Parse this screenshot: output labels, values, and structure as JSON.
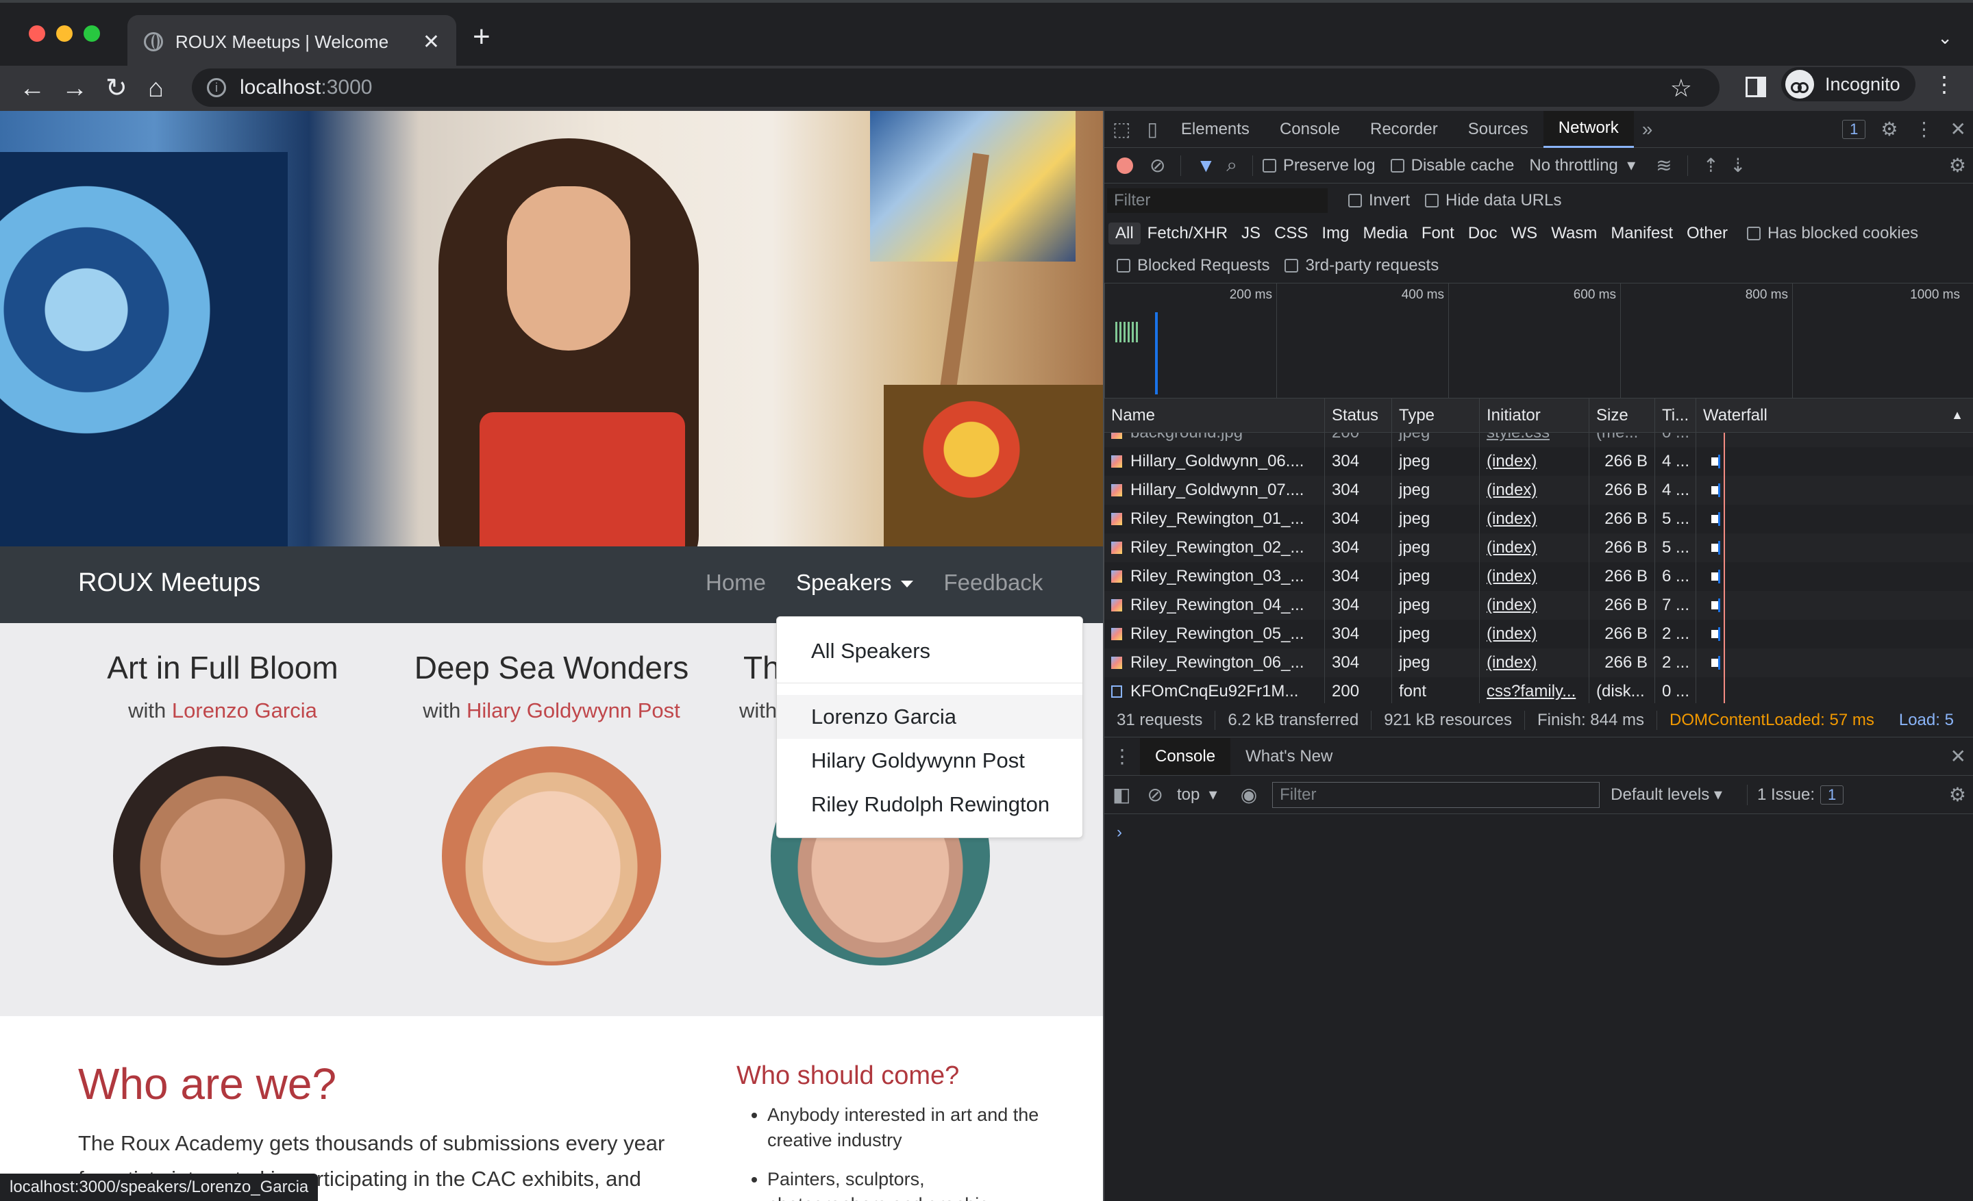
{
  "browser": {
    "tab_title": "ROUX Meetups | Welcome",
    "url_host": "localhost",
    "url_port": ":3000",
    "profile_label": "Incognito",
    "new_tab_symbol": "+"
  },
  "site": {
    "brand": "ROUX Meetups",
    "nav": {
      "home": "Home",
      "speakers": "Speakers",
      "feedback": "Feedback"
    },
    "dropdown": {
      "all": "All Speakers",
      "items": [
        "Lorenzo Garcia",
        "Hilary Goldywynn Post",
        "Riley Rudolph Rewington"
      ]
    },
    "speakers": [
      {
        "title": "Art in Full Bloom",
        "with": "with ",
        "name": "Lorenzo Garcia"
      },
      {
        "title": "Deep Sea Wonders",
        "with": "with ",
        "name": "Hilary Goldywynn Post"
      },
      {
        "title": "Th",
        "with": "with",
        "name": ""
      }
    ],
    "who_title": "Who are we?",
    "who_text": "The Roux Academy gets thousands of submissions every year for artists interested in participating in the CAC exhibits, and",
    "who_should_title": "Who should come?",
    "who_should_list": [
      "Anybody interested in art and the creative industry",
      "Painters, sculptors, photographers and graphic"
    ]
  },
  "status_bar": "localhost:3000/speakers/Lorenzo_Garcia",
  "devtools": {
    "tabs": [
      "Elements",
      "Console",
      "Recorder",
      "Sources",
      "Network"
    ],
    "active_tab": "Network",
    "issues_badge": "1",
    "toolbar": {
      "preserve_log": "Preserve log",
      "disable_cache": "Disable cache",
      "throttling": "No throttling"
    },
    "filter_placeholder": "Filter",
    "invert": "Invert",
    "hide_data_urls": "Hide data URLs",
    "types": [
      "All",
      "Fetch/XHR",
      "JS",
      "CSS",
      "Img",
      "Media",
      "Font",
      "Doc",
      "WS",
      "Wasm",
      "Manifest",
      "Other"
    ],
    "has_blocked_cookies": "Has blocked cookies",
    "blocked_requests": "Blocked Requests",
    "third_party": "3rd-party requests",
    "timeline_ticks": [
      "200 ms",
      "400 ms",
      "600 ms",
      "800 ms",
      "1000 ms"
    ],
    "columns": [
      "Name",
      "Status",
      "Type",
      "Initiator",
      "Size",
      "Ti...",
      "Waterfall"
    ],
    "rows": [
      {
        "name": "background.jpg",
        "status": "200",
        "type": "jpeg",
        "initiator": "style.css",
        "size": "(me...",
        "time": "0 ..."
      },
      {
        "name": "Hillary_Goldwynn_06....",
        "status": "304",
        "type": "jpeg",
        "initiator": "(index)",
        "size": "266 B",
        "time": "4 ..."
      },
      {
        "name": "Hillary_Goldwynn_07....",
        "status": "304",
        "type": "jpeg",
        "initiator": "(index)",
        "size": "266 B",
        "time": "4 ..."
      },
      {
        "name": "Riley_Rewington_01_...",
        "status": "304",
        "type": "jpeg",
        "initiator": "(index)",
        "size": "266 B",
        "time": "5 ..."
      },
      {
        "name": "Riley_Rewington_02_...",
        "status": "304",
        "type": "jpeg",
        "initiator": "(index)",
        "size": "266 B",
        "time": "5 ..."
      },
      {
        "name": "Riley_Rewington_03_...",
        "status": "304",
        "type": "jpeg",
        "initiator": "(index)",
        "size": "266 B",
        "time": "6 ..."
      },
      {
        "name": "Riley_Rewington_04_...",
        "status": "304",
        "type": "jpeg",
        "initiator": "(index)",
        "size": "266 B",
        "time": "7 ..."
      },
      {
        "name": "Riley_Rewington_05_...",
        "status": "304",
        "type": "jpeg",
        "initiator": "(index)",
        "size": "266 B",
        "time": "2 ..."
      },
      {
        "name": "Riley_Rewington_06_...",
        "status": "304",
        "type": "jpeg",
        "initiator": "(index)",
        "size": "266 B",
        "time": "2 ..."
      },
      {
        "name": "KFOmCnqEu92Fr1M...",
        "status": "200",
        "type": "font",
        "initiator": "css?family...",
        "size": "(disk...",
        "time": "0 ..."
      }
    ],
    "summary": {
      "requests": "31 requests",
      "transferred": "6.2 kB transferred",
      "resources": "921 kB resources",
      "finish": "Finish: 844 ms",
      "dom_content_loaded": "DOMContentLoaded: 57 ms",
      "load": "Load: 5"
    },
    "drawer": {
      "tabs": [
        "Console",
        "What's New"
      ],
      "context": "top",
      "filter_placeholder": "Filter",
      "levels": "Default levels",
      "issues": "1 Issue:",
      "issues_count": "1"
    }
  }
}
